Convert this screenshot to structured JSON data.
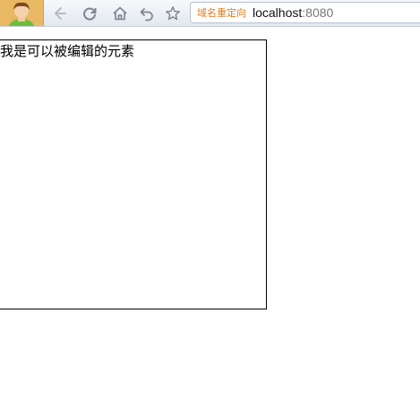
{
  "browser": {
    "toolbar_buttons": [
      {
        "name": "back",
        "icon": "arrow-left-icon"
      },
      {
        "name": "reload",
        "icon": "reload-icon"
      },
      {
        "name": "home",
        "icon": "home-icon"
      },
      {
        "name": "undo",
        "icon": "undo-icon"
      },
      {
        "name": "favorite",
        "icon": "star-icon"
      }
    ],
    "address_bar": {
      "badge": "域名重定向",
      "host": "localhost",
      "port": ":8080"
    },
    "colors": {
      "badge": "#e07b1c",
      "toolbar": "#e3e8ef"
    }
  },
  "page": {
    "editable_text": "我是可以被编辑的元素"
  }
}
